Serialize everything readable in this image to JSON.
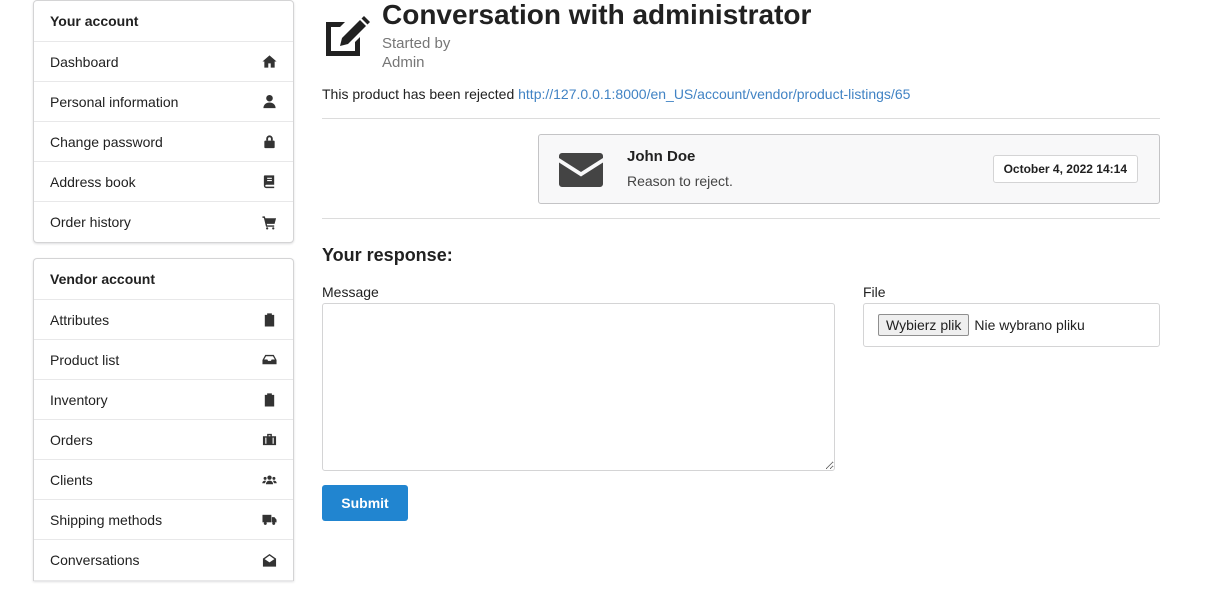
{
  "sidebar": {
    "account": {
      "header": "Your account",
      "items": [
        {
          "label": "Dashboard",
          "icon": "home-icon"
        },
        {
          "label": "Personal information",
          "icon": "user-icon"
        },
        {
          "label": "Change password",
          "icon": "lock-icon"
        },
        {
          "label": "Address book",
          "icon": "book-icon"
        },
        {
          "label": "Order history",
          "icon": "cart-icon"
        }
      ]
    },
    "vendor": {
      "header": "Vendor account",
      "items": [
        {
          "label": "Attributes",
          "icon": "clipboard-icon"
        },
        {
          "label": "Product list",
          "icon": "inbox-icon"
        },
        {
          "label": "Inventory",
          "icon": "clipboard-icon"
        },
        {
          "label": "Orders",
          "icon": "briefcase-icon"
        },
        {
          "label": "Clients",
          "icon": "users-icon"
        },
        {
          "label": "Shipping methods",
          "icon": "truck-icon"
        },
        {
          "label": "Conversations",
          "icon": "envelope-open-icon"
        }
      ]
    }
  },
  "main": {
    "title": "Conversation with administrator",
    "started_by_label": "Started by",
    "started_by_name": "Admin",
    "notice_text": "This product has been rejected",
    "notice_link": "http://127.0.0.1:8000/en_US/account/vendor/product-listings/65",
    "message": {
      "author": "John Doe",
      "text": "Reason to reject.",
      "date": "October 4, 2022 14:14"
    },
    "response_title": "Your response:",
    "message_label": "Message",
    "file_label": "File",
    "file_button": "Wybierz plik",
    "file_none": "Nie wybrano pliku",
    "submit_label": "Submit"
  },
  "colors": {
    "primary": "#2185d0",
    "link": "#4183c4",
    "text": "#212121",
    "muted": "#767676"
  }
}
